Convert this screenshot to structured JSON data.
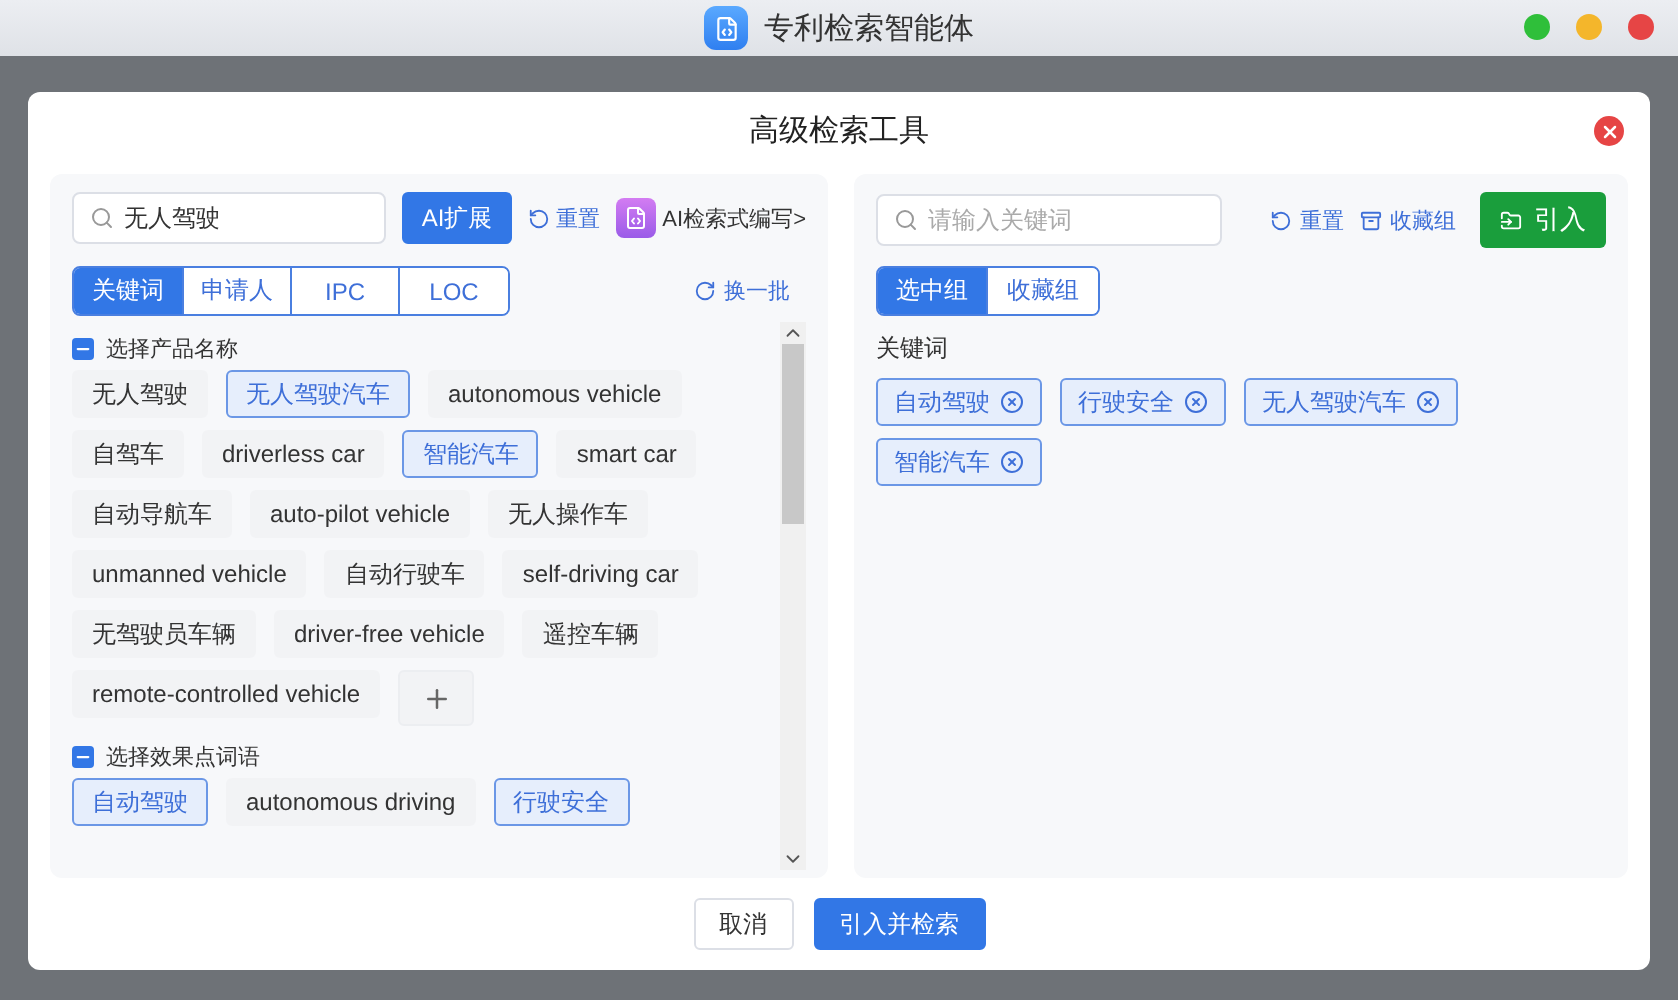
{
  "window": {
    "title": "专利检索智能体"
  },
  "dialog": {
    "title": "高级检索工具",
    "left": {
      "search": {
        "value": "无人驾驶"
      },
      "ai_button": "AI扩展",
      "reset_link": "重置",
      "ai_write_link": "AI检索式编写>",
      "tabs": [
        {
          "label": "关键词",
          "selected": true
        },
        {
          "label": "申请人",
          "selected": false
        },
        {
          "label": "IPC",
          "selected": false
        },
        {
          "label": "LOC",
          "selected": false
        }
      ],
      "refresh_link": "换一批",
      "groups": [
        {
          "label": "选择产品名称",
          "partial": true,
          "chips": [
            {
              "text": "无人驾驶",
              "selected": false
            },
            {
              "text": "无人驾驶汽车",
              "selected": true
            },
            {
              "text": "autonomous vehicle",
              "selected": false
            },
            {
              "text": "自驾车",
              "selected": false
            },
            {
              "text": "driverless car",
              "selected": false
            },
            {
              "text": "智能汽车",
              "selected": true
            },
            {
              "text": "smart car",
              "selected": false
            },
            {
              "text": "自动导航车",
              "selected": false
            },
            {
              "text": "auto-pilot vehicle",
              "selected": false
            },
            {
              "text": "无人操作车",
              "selected": false
            },
            {
              "text": "unmanned vehicle",
              "selected": false
            },
            {
              "text": "自动行驶车",
              "selected": false
            },
            {
              "text": "self-driving car",
              "selected": false
            },
            {
              "text": "无驾驶员车辆",
              "selected": false
            },
            {
              "text": "driver-free vehicle",
              "selected": false
            },
            {
              "text": "遥控车辆",
              "selected": false
            },
            {
              "text": "remote-controlled vehicle",
              "selected": false
            }
          ],
          "addable": true
        },
        {
          "label": "选择效果点词语",
          "partial": true,
          "chips": [
            {
              "text": "自动驾驶",
              "selected": true
            },
            {
              "text": "autonomous driving",
              "selected": false
            },
            {
              "text": "行驶安全",
              "selected": true
            }
          ]
        }
      ]
    },
    "right": {
      "search": {
        "placeholder": "请输入关键词"
      },
      "reset_link": "重置",
      "favorites_link": "收藏组",
      "import_button": "引入",
      "tabs": [
        {
          "label": "选中组",
          "selected": true
        },
        {
          "label": "收藏组",
          "selected": false
        }
      ],
      "section_label": "关键词",
      "chips": [
        "自动驾驶",
        "行驶安全",
        "无人驾驶汽车",
        "智能汽车"
      ]
    },
    "buttons": [
      {
        "label": "取消",
        "kind": "secondary"
      },
      {
        "label": "引入并检索",
        "kind": "primary"
      }
    ]
  }
}
